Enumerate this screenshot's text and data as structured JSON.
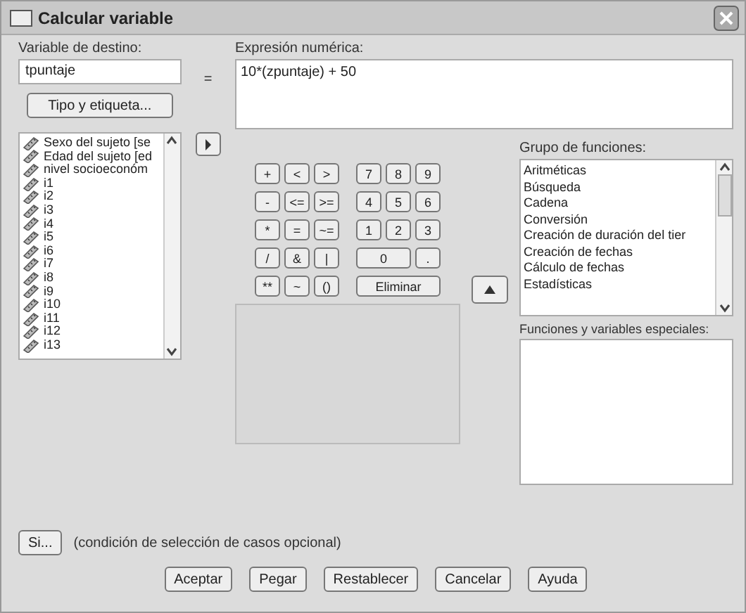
{
  "window": {
    "title": "Calcular variable"
  },
  "target": {
    "label": "Variable de destino:",
    "value": "tpuntaje"
  },
  "type_button": "Tipo y etiqueta...",
  "equals": "=",
  "expression": {
    "label": "Expresión numérica:",
    "value": "10*(zpuntaje) + 50"
  },
  "variables": [
    {
      "name": "Sexo del sujeto [se"
    },
    {
      "name": "Edad del sujeto [ed"
    },
    {
      "name": "nivel socioeconóm"
    },
    {
      "name": "i1"
    },
    {
      "name": "i2"
    },
    {
      "name": "i3"
    },
    {
      "name": "i4"
    },
    {
      "name": "i5"
    },
    {
      "name": "i6"
    },
    {
      "name": "i7"
    },
    {
      "name": "i8"
    },
    {
      "name": "i9"
    },
    {
      "name": "i10"
    },
    {
      "name": "i11"
    },
    {
      "name": "i12"
    },
    {
      "name": "i13"
    }
  ],
  "keypad": [
    [
      "+",
      "<",
      ">",
      "7",
      "8",
      "9"
    ],
    [
      "-",
      "<=",
      ">=",
      "4",
      "5",
      "6"
    ],
    [
      "*",
      "=",
      "~=",
      "1",
      "2",
      "3"
    ],
    [
      "/",
      "&",
      "|",
      "0",
      "."
    ],
    [
      "**",
      "~",
      "()",
      "Eliminar"
    ]
  ],
  "function_groups": {
    "label": "Grupo de funciones:",
    "items": [
      "Aritméticas",
      "Búsqueda",
      "Cadena",
      "Conversión",
      "Creación de duración del tier",
      "Creación de fechas",
      "Cálculo de fechas",
      "Estadísticas"
    ]
  },
  "special_functions": {
    "label": "Funciones y variables especiales:"
  },
  "if_button": "Si...",
  "if_note": "(condición de selección de casos opcional)",
  "buttons": [
    "Aceptar",
    "Pegar",
    "Restablecer",
    "Cancelar",
    "Ayuda"
  ]
}
